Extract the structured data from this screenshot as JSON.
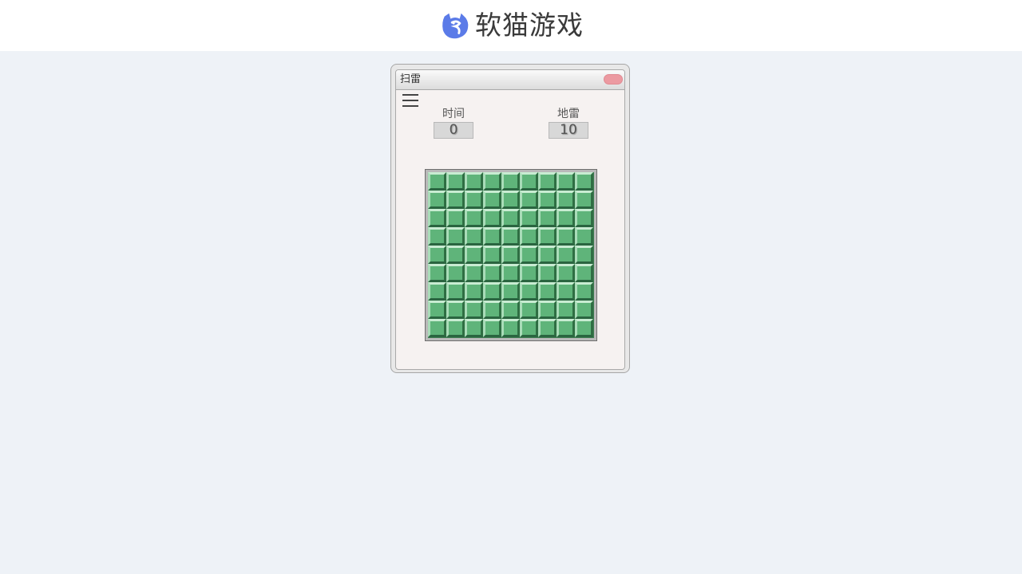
{
  "brand": {
    "name": "软猫游戏",
    "accent": "#5b7be8"
  },
  "window": {
    "title": "扫雷"
  },
  "stats": {
    "time_label": "时间",
    "time_value": "0",
    "mines_label": "地雷",
    "mines_value": "10"
  },
  "board": {
    "rows": 9,
    "cols": 9,
    "cell_state": "covered"
  },
  "icons": {
    "menu": "menu-icon",
    "close": "close-icon",
    "logo": "cat-logo-icon"
  },
  "colors": {
    "cell": "#5fb47a",
    "close_button": "#ec9aa1",
    "background": "#eef2f7"
  }
}
